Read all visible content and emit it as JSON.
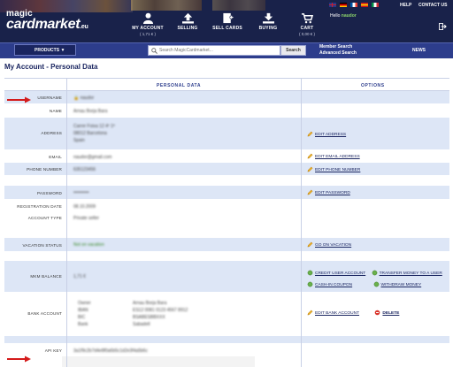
{
  "header": {
    "logo_line1": "magic",
    "logo_line2": "cardmarket",
    "logo_tld": ".eu",
    "nav": [
      {
        "label": "MY ACCOUNT",
        "sub": "( 1,71 € )"
      },
      {
        "label": "SELLING",
        "sub": ""
      },
      {
        "label": "SELL CARDS",
        "sub": ""
      },
      {
        "label": "BUYING",
        "sub": ""
      },
      {
        "label": "CART",
        "sub": "( 0,00 € )"
      }
    ],
    "help": "HELP",
    "contact": "CONTACT US",
    "hello_prefix": "Hello",
    "username": "naudor",
    "colors": {
      "header_bg": "#19224a",
      "menubar_bg": "#2d3d8c",
      "accent_green": "#8bd36a"
    }
  },
  "menubar": {
    "products": "PRODUCTS ▼",
    "search_placeholder": "Search MagicCardmarket...",
    "search_button": "Search",
    "member_search": "Member Search",
    "advanced_search": "Advanced Search",
    "news": "NEWS"
  },
  "page": {
    "title": "My Account - Personal Data",
    "col_personal": "PERSONAL DATA",
    "col_options": "OPTIONS"
  },
  "rows": {
    "username": {
      "label": "USERNAME",
      "value": "naudor"
    },
    "name": {
      "label": "NAME",
      "value": "Arnau Borja Bara"
    },
    "address": {
      "label": "ADDRESS",
      "line1": "Carrer Foixa 12 4º 1ª",
      "line2": "08012 Barcelona",
      "line3": "Spain",
      "option": "EDIT ADDRESS"
    },
    "email": {
      "label": "EMAIL",
      "value": "naudor@gmail.com",
      "option": "EDIT EMAIL ADDRESS"
    },
    "phone": {
      "label": "PHONE NUMBER",
      "value": "635123456",
      "option": "EDIT PHONE NUMBER"
    },
    "password": {
      "label": "PASSWORD",
      "value": "••••••••••",
      "option": "EDIT PASSWORD"
    },
    "registration": {
      "label": "REGISTRATION DATE",
      "value": "08.10.2009"
    },
    "account_type": {
      "label": "ACCOUNT TYPE",
      "value": "Private seller"
    },
    "vacation": {
      "label": "VACATION STATUS",
      "value": "Not on vacation",
      "option": "GO ON VACATION"
    },
    "balance": {
      "label": "MKM BALANCE",
      "value": "1,71 €",
      "opt1": "CREDIT USER ACCOUNT",
      "opt2": "TRANSFER MONEY TO A USER",
      "opt3": "CASH-IN COUPON",
      "opt4": "WITHDRAW MONEY"
    },
    "bank": {
      "label": "BANK ACCOUNT",
      "k1": "Owner",
      "v1": "Arnau Borja Bara",
      "k2": "IBAN",
      "v2": "ES12 0081 0123 4567 8912",
      "k3": "BIC",
      "v3": "BSABESBBXXX",
      "k4": "Bank",
      "v4": "Sabadell",
      "option": "EDIT BANK ACCOUNT",
      "delete": "DELETE"
    },
    "apikey": {
      "label": "API KEY",
      "value": "3a1f9c2b7d4e8f0a6b5c1d2e3f4a5b6c"
    }
  }
}
